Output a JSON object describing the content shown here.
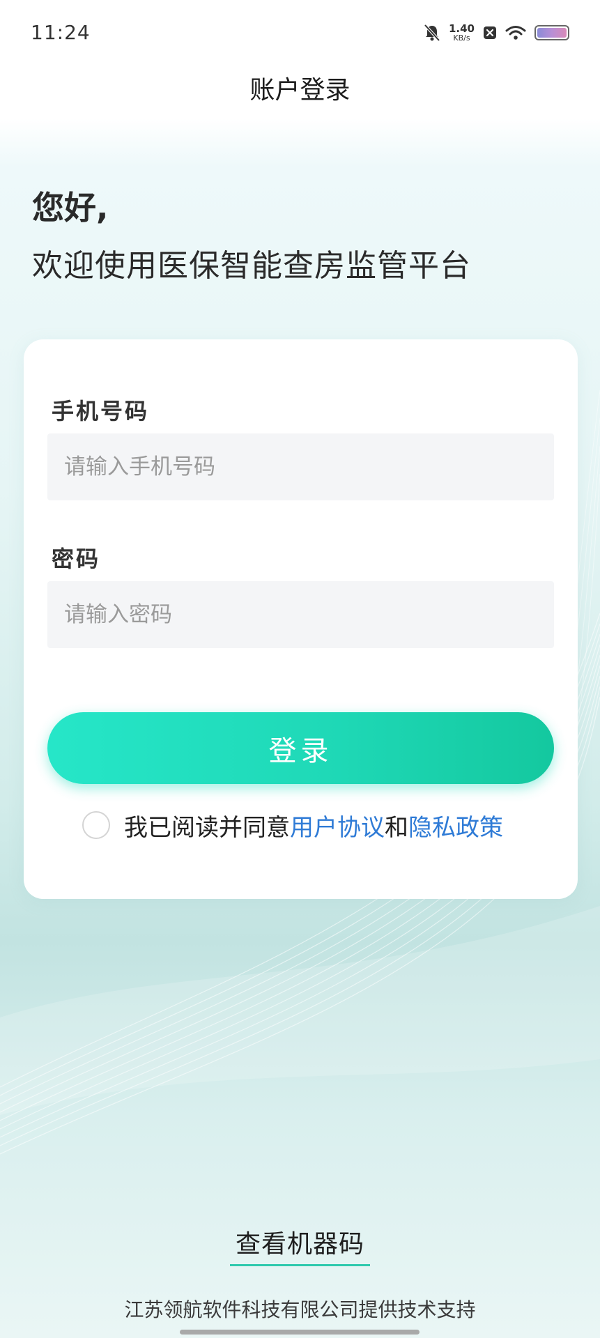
{
  "status_bar": {
    "time": "11:24",
    "net_speed_value": "1.40",
    "net_speed_unit": "KB/s",
    "icons": [
      "bell-off-icon",
      "close-box-icon",
      "wifi-icon",
      "battery-icon"
    ]
  },
  "header": {
    "title": "账户登录"
  },
  "intro": {
    "greeting": "您好,",
    "welcome": "欢迎使用医保智能查房监管平台"
  },
  "form": {
    "phone_label": "手机号码",
    "phone_placeholder": "请输入手机号码",
    "phone_value": "",
    "password_label": "密码",
    "password_placeholder": "请输入密码",
    "password_value": "",
    "login_label": "登录",
    "agreement": {
      "prefix": "我已阅读并同意",
      "user_agreement": "用户协议",
      "conjunction": "和",
      "privacy_policy": "隐私政策",
      "checked": false
    }
  },
  "machine_code_link": "查看机器码",
  "footer_text": "江苏领航软件科技有限公司提供技术支持",
  "colors": {
    "accent_start": "#26e6c8",
    "accent_end": "#14c89f",
    "link": "#2f7bd6"
  }
}
